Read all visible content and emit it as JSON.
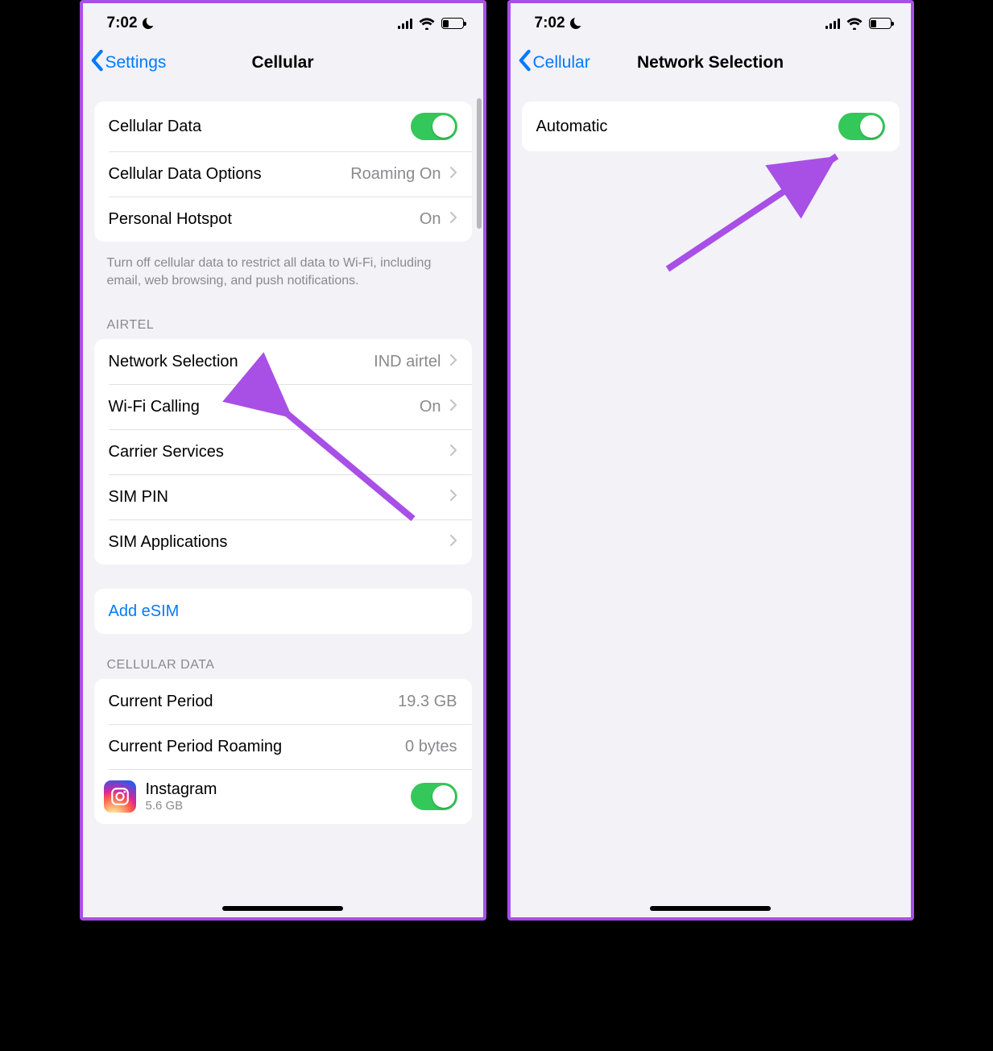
{
  "status": {
    "time": "7:02"
  },
  "left": {
    "back_label": "Settings",
    "title": "Cellular",
    "rows": {
      "cellular_data": "Cellular Data",
      "cellular_data_options": {
        "label": "Cellular Data Options",
        "value": "Roaming On"
      },
      "personal_hotspot": {
        "label": "Personal Hotspot",
        "value": "On"
      }
    },
    "footnote": "Turn off cellular data to restrict all data to Wi-Fi, including email, web browsing, and push notifications.",
    "carrier_header": "AIRTEL",
    "carrier_rows": {
      "network_selection": {
        "label": "Network Selection",
        "value": "IND airtel"
      },
      "wifi_calling": {
        "label": "Wi-Fi Calling",
        "value": "On"
      },
      "carrier_services": "Carrier Services",
      "sim_pin": "SIM PIN",
      "sim_applications": "SIM Applications"
    },
    "add_esim": "Add eSIM",
    "data_header": "CELLULAR DATA",
    "data_rows": {
      "current_period": {
        "label": "Current Period",
        "value": "19.3 GB"
      },
      "current_period_roaming": {
        "label": "Current Period Roaming",
        "value": "0 bytes"
      },
      "instagram": {
        "label": "Instagram",
        "subtitle": "5.6 GB"
      }
    }
  },
  "right": {
    "back_label": "Cellular",
    "title": "Network Selection",
    "automatic": "Automatic"
  }
}
